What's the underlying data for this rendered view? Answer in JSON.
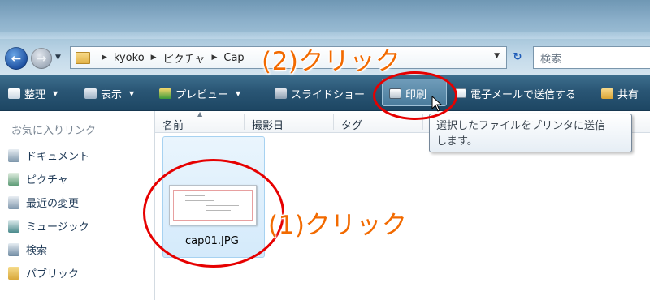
{
  "address_bar": {
    "crumbs": [
      "kyoko",
      "ピクチャ",
      "Cap"
    ]
  },
  "search": {
    "placeholder": "検索"
  },
  "toolbar": {
    "organize": "整理",
    "view": "表示",
    "preview": "プレビュー",
    "slideshow": "スライドショー",
    "print": "印刷",
    "email": "電子メールで送信する",
    "share": "共有"
  },
  "sidebar": {
    "title": "お気に入りリンク",
    "items": [
      {
        "label": "ドキュメント",
        "icon": "documents-icon"
      },
      {
        "label": "ピクチャ",
        "icon": "pictures-icon"
      },
      {
        "label": "最近の変更",
        "icon": "recent-changes-icon"
      },
      {
        "label": "ミュージック",
        "icon": "music-icon"
      },
      {
        "label": "検索",
        "icon": "search-folder-icon"
      },
      {
        "label": "パブリック",
        "icon": "public-folder-icon"
      }
    ]
  },
  "columns": [
    "名前",
    "撮影日",
    "タグ"
  ],
  "file": {
    "name": "cap01.JPG"
  },
  "tooltip": {
    "line1": "選択したファイルをプリンタに送信",
    "line2": "します。"
  },
  "annotations": {
    "step1": "(1)クリック",
    "step2": "(2)クリック"
  },
  "colors": {
    "annotation": "#f26a00",
    "circle": "#e60000",
    "toolbar": "#2a5675"
  }
}
